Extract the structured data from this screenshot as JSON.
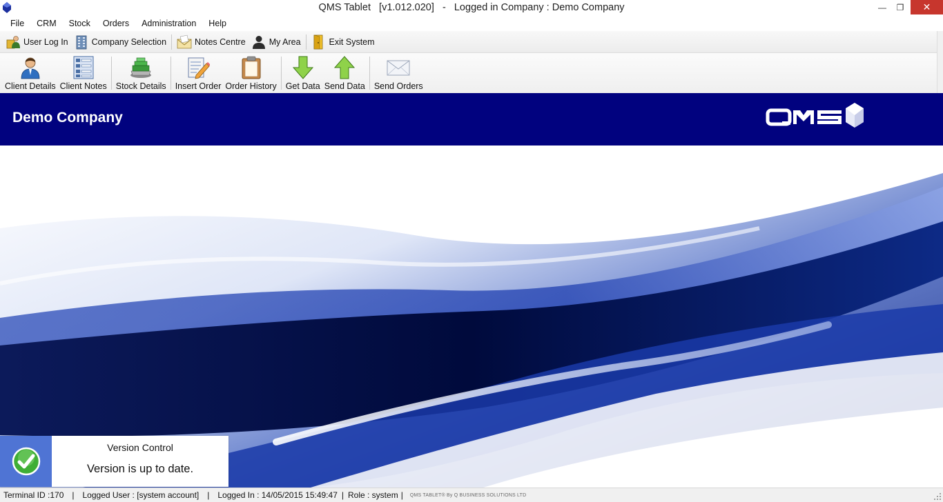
{
  "window": {
    "title": "QMS Tablet   [v1.012.020]   -   Logged in Company : Demo Company",
    "minimize_glyph": "—",
    "restore_glyph": "❐",
    "close_glyph": "✕"
  },
  "menu": {
    "items": [
      "File",
      "CRM",
      "Stock",
      "Orders",
      "Administration",
      "Help"
    ]
  },
  "toolbar1": {
    "items": [
      {
        "label": "User Log In",
        "icon": "user-login-icon"
      },
      {
        "label": "Company Selection",
        "icon": "building-icon"
      },
      {
        "label": "Notes Centre",
        "icon": "envelope-notes-icon"
      },
      {
        "label": "My Area",
        "icon": "person-silhouette-icon"
      },
      {
        "label": "Exit System",
        "icon": "exit-door-icon"
      }
    ]
  },
  "toolbar2": {
    "items": [
      {
        "label": "Client Details",
        "icon": "client-person-icon"
      },
      {
        "label": "Client Notes",
        "icon": "list-notes-icon"
      },
      {
        "label": "Stock Details",
        "icon": "stock-pile-icon"
      },
      {
        "label": "Insert Order",
        "icon": "pencil-document-icon"
      },
      {
        "label": "Order History",
        "icon": "clipboard-icon"
      },
      {
        "label": "Get Data",
        "icon": "arrow-down-icon"
      },
      {
        "label": "Send Data",
        "icon": "arrow-up-icon"
      },
      {
        "label": "Send Orders",
        "icon": "envelope-icon"
      }
    ]
  },
  "banner": {
    "company_name": "Demo Company",
    "background_color": "#01027f"
  },
  "notification": {
    "title": "Version Control",
    "message": "Version is up to date.",
    "icon": "check-circle-icon",
    "accent_color": "#4f74d4"
  },
  "statusbar": {
    "terminal": "Terminal ID :170",
    "user": "Logged User : [system account]",
    "logged_in": "Logged In : 14/05/2015 15:49:47",
    "role": "Role : system",
    "separator": "|",
    "credit": "QMS TABLET® By Q BUSINESS SOLUTIONS LTD"
  }
}
